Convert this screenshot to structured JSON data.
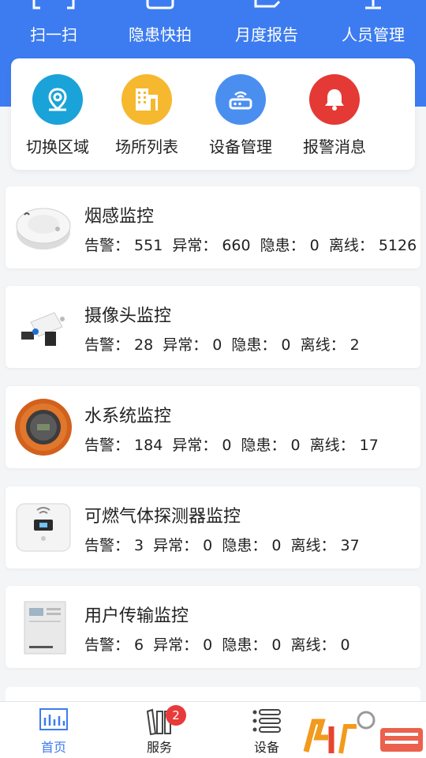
{
  "top_actions": [
    {
      "label": "扫一扫",
      "icon": "scan-icon"
    },
    {
      "label": "隐患快拍",
      "icon": "camera-icon"
    },
    {
      "label": "月度报告",
      "icon": "report-icon"
    },
    {
      "label": "人员管理",
      "icon": "people-icon"
    }
  ],
  "quick_menu": [
    {
      "label": "切换区域",
      "icon": "location-pin-icon",
      "color": "#1aa3d8"
    },
    {
      "label": "场所列表",
      "icon": "building-icon",
      "color": "#f5b82e"
    },
    {
      "label": "设备管理",
      "icon": "router-icon",
      "color": "#4a8ff0"
    },
    {
      "label": "报警消息",
      "icon": "bell-icon",
      "color": "#e53935"
    }
  ],
  "monitors": [
    {
      "title": "烟感监控",
      "alarm_label": "告警：",
      "alarm": "551",
      "abnormal_label": "异常：",
      "abnormal": "660",
      "hazard_label": "隐患：",
      "hazard": "0",
      "offline_label": "离线：",
      "offline": "5126",
      "thumb": "smoke-detector-image"
    },
    {
      "title": "摄像头监控",
      "alarm_label": "告警：",
      "alarm": "28",
      "abnormal_label": "异常：",
      "abnormal": "0",
      "hazard_label": "隐患：",
      "hazard": "0",
      "offline_label": "离线：",
      "offline": "2",
      "thumb": "camera-image"
    },
    {
      "title": "水系统监控",
      "alarm_label": "告警：",
      "alarm": "184",
      "abnormal_label": "异常：",
      "abnormal": "0",
      "hazard_label": "隐患：",
      "hazard": "0",
      "offline_label": "离线：",
      "offline": "17",
      "thumb": "water-gauge-image"
    },
    {
      "title": "可燃气体探测器监控",
      "alarm_label": "告警：",
      "alarm": "3",
      "abnormal_label": "异常：",
      "abnormal": "0",
      "hazard_label": "隐患：",
      "hazard": "0",
      "offline_label": "离线：",
      "offline": "37",
      "thumb": "gas-detector-image"
    },
    {
      "title": "用户传输监控",
      "alarm_label": "告警：",
      "alarm": "6",
      "abnormal_label": "异常：",
      "abnormal": "0",
      "hazard_label": "隐患：",
      "hazard": "0",
      "offline_label": "离线：",
      "offline": "0",
      "thumb": "transmission-device-image"
    }
  ],
  "tabs": [
    {
      "label": "首页",
      "icon": "chart-icon",
      "active": true
    },
    {
      "label": "服务",
      "icon": "books-icon",
      "badge": "2"
    },
    {
      "label": "设备",
      "icon": "list-icon"
    }
  ],
  "colors": {
    "primary": "#3d7cf0",
    "badge": "#e83a3a"
  }
}
